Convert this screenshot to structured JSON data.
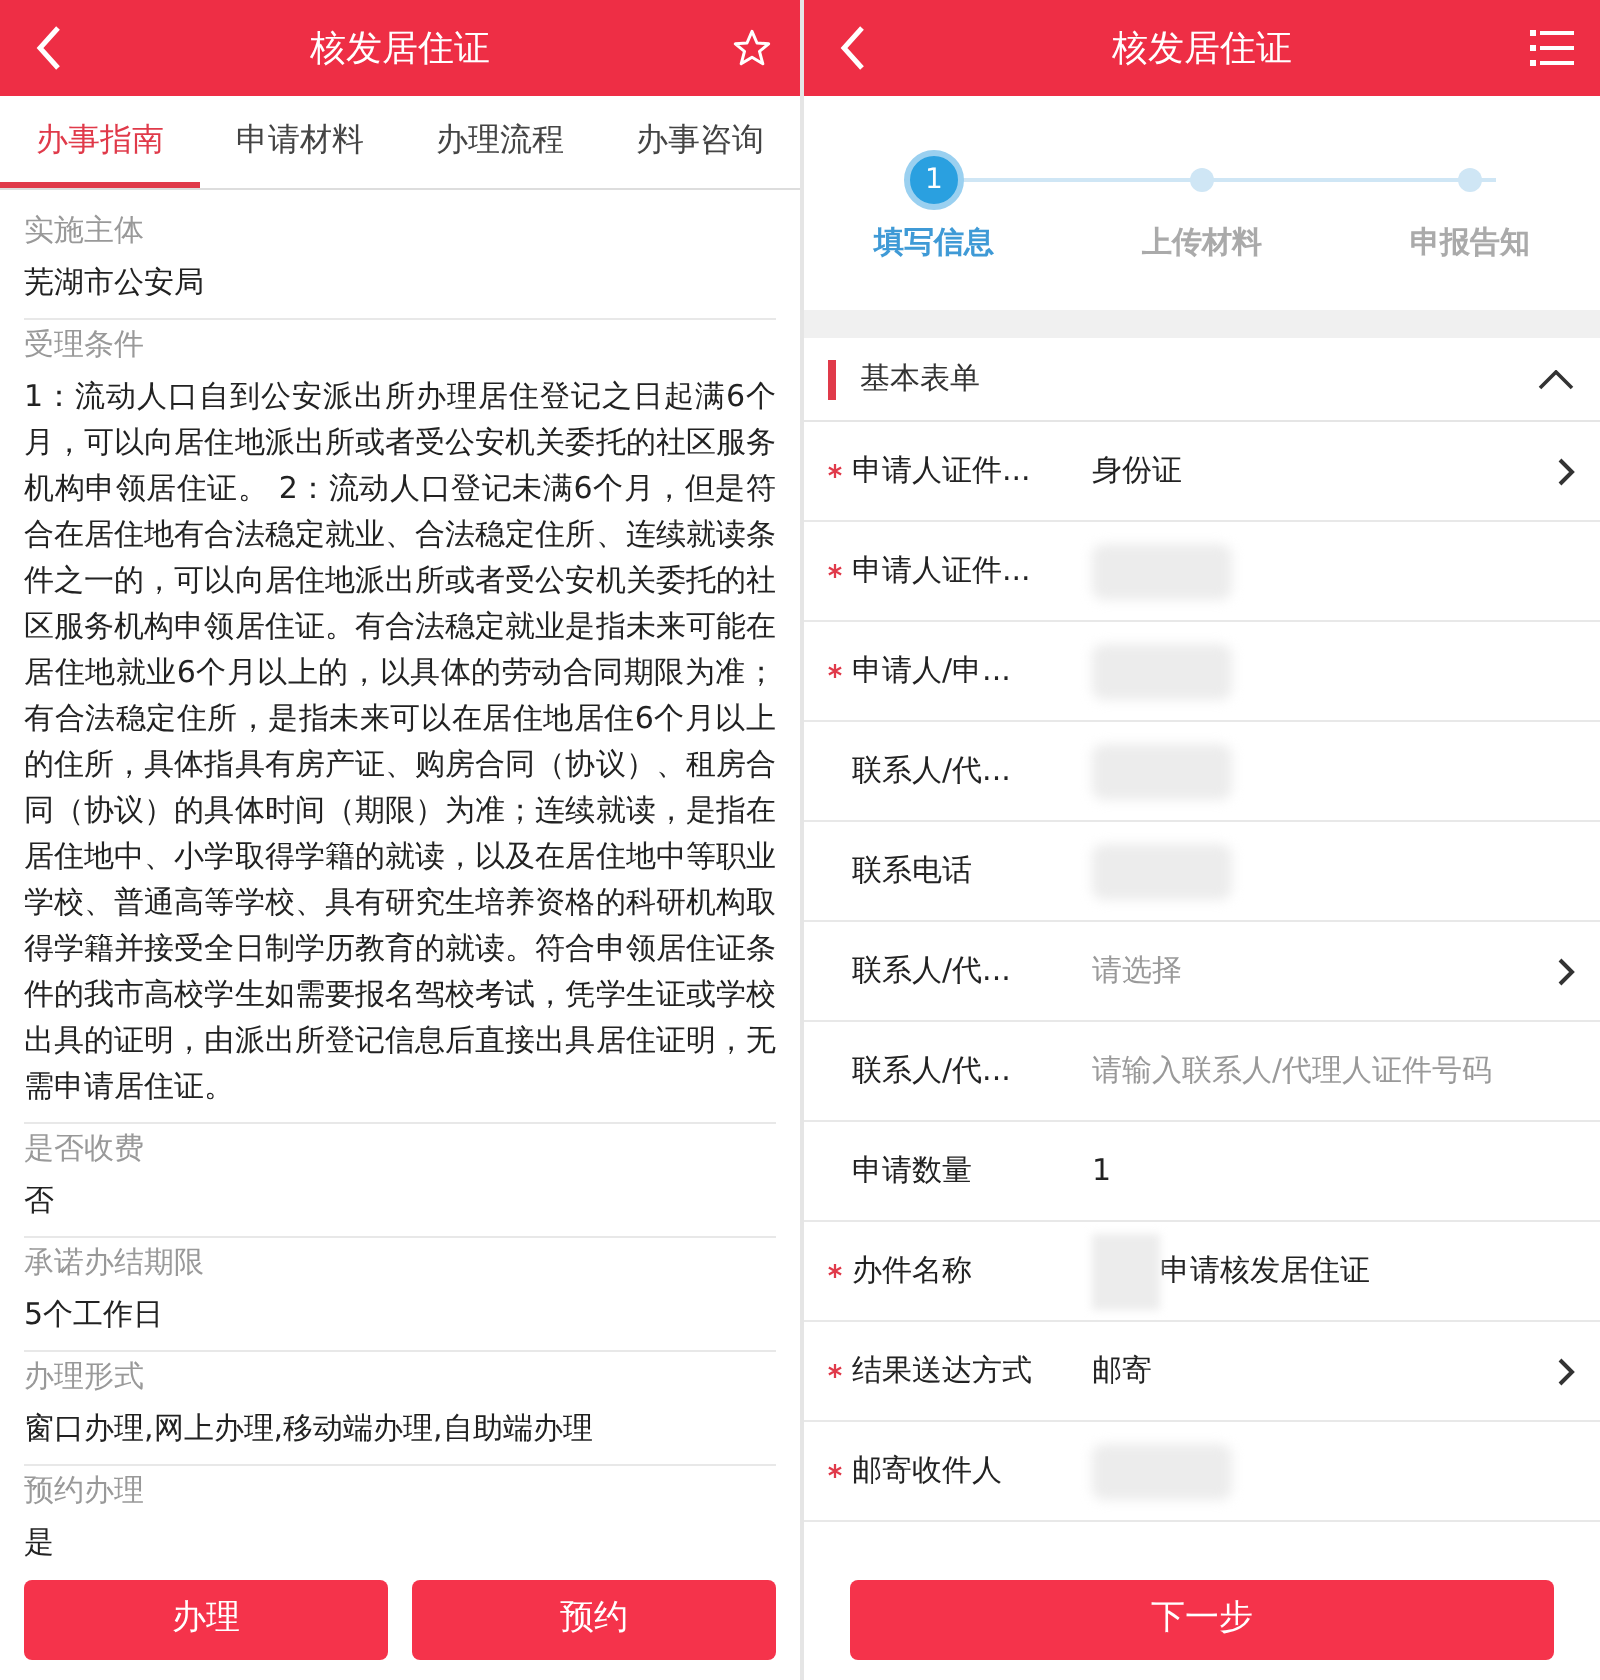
{
  "left": {
    "header": {
      "title": "核发居住证"
    },
    "tabs": [
      {
        "label": "办事指南",
        "selected": true
      },
      {
        "label": "申请材料",
        "selected": false
      },
      {
        "label": "办理流程",
        "selected": false
      },
      {
        "label": "办事咨询",
        "selected": false
      }
    ],
    "sections": [
      {
        "label": "实施主体",
        "value": "芜湖市公安局"
      },
      {
        "label": "受理条件",
        "value": "1：流动人口自到公安派出所办理居住登记之日起满6个月，可以向居住地派出所或者受公安机关委托的社区服务机构申领居住证。 2：流动人口登记未满6个月，但是符合在居住地有合法稳定就业、合法稳定住所、连续就读条件之一的，可以向居住地派出所或者受公安机关委托的社区服务机构申领居住证。有合法稳定就业是指未来可能在居住地就业6个月以上的，以具体的劳动合同期限为准；有合法稳定住所，是指未来可以在居住地居住6个月以上的住所，具体指具有房产证、购房合同（协议）、租房合同（协议）的具体时间（期限）为准；连续就读，是指在居住地中、小学取得学籍的就读，以及在居住地中等职业学校、普通高等学校、具有研究生培养资格的科研机构取得学籍并接受全日制学历教育的就读。符合申领居住证条件的我市高校学生如需要报名驾校考试，凭学生证或学校出具的证明，由派出所登记信息后直接出具居住证明，无需申请居住证。"
      },
      {
        "label": "是否收费",
        "value": "否"
      },
      {
        "label": "承诺办结期限",
        "value": "5个工作日"
      },
      {
        "label": "办理形式",
        "value": "窗口办理,网上办理,移动端办理,自助端办理"
      },
      {
        "label": "预约办理",
        "value": "是"
      }
    ],
    "buttons": [
      "办理",
      "预约"
    ]
  },
  "right": {
    "header": {
      "title": "核发居住证"
    },
    "steps": [
      {
        "number": "1",
        "label": "填写信息",
        "selected": true
      },
      {
        "label": "上传材料",
        "selected": false
      },
      {
        "label": "申报告知",
        "selected": false
      }
    ],
    "section": {
      "title": "基本表单",
      "expanded": true
    },
    "fields": [
      {
        "kind": "select",
        "required": true,
        "label": "申请人证件...",
        "value": "身份证"
      },
      {
        "kind": "blurred",
        "required": true,
        "label": "申请人证件..."
      },
      {
        "kind": "blurred",
        "required": true,
        "label": "申请人/申..."
      },
      {
        "kind": "blurred",
        "required": false,
        "label": "联系人/代..."
      },
      {
        "kind": "blurred",
        "required": false,
        "label": "联系电话"
      },
      {
        "kind": "select",
        "required": false,
        "label": "联系人/代...",
        "placeholder": "请选择"
      },
      {
        "kind": "input",
        "required": false,
        "label": "联系人/代...",
        "placeholder": "请输入联系人/代理人证件号码"
      },
      {
        "kind": "text",
        "required": false,
        "label": "申请数量",
        "value": "1"
      },
      {
        "kind": "partial",
        "required": true,
        "label": "办件名称",
        "value": "申请核发居住证"
      },
      {
        "kind": "select",
        "required": true,
        "label": "结果送达方式",
        "value": "邮寄"
      },
      {
        "kind": "blurred",
        "required": true,
        "label": "邮寄收件人"
      }
    ],
    "button": "下一步"
  }
}
